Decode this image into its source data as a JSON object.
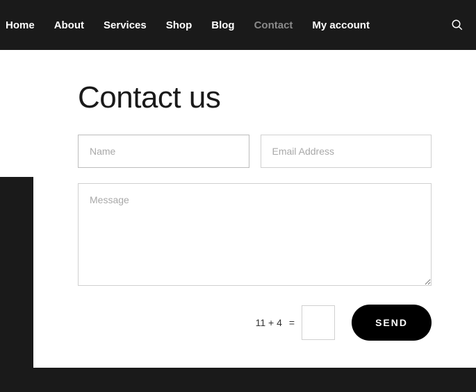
{
  "nav": {
    "items": [
      {
        "label": "Home",
        "active": false
      },
      {
        "label": "About",
        "active": false
      },
      {
        "label": "Services",
        "active": false
      },
      {
        "label": "Shop",
        "active": false
      },
      {
        "label": "Blog",
        "active": false
      },
      {
        "label": "Contact",
        "active": true
      },
      {
        "label": "My account",
        "active": false
      }
    ]
  },
  "page": {
    "title": "Contact us"
  },
  "form": {
    "name_placeholder": "Name",
    "email_placeholder": "Email Address",
    "message_placeholder": "Message",
    "captcha_question": "11 + 4",
    "captcha_equals": "=",
    "send_label": "SEND"
  }
}
